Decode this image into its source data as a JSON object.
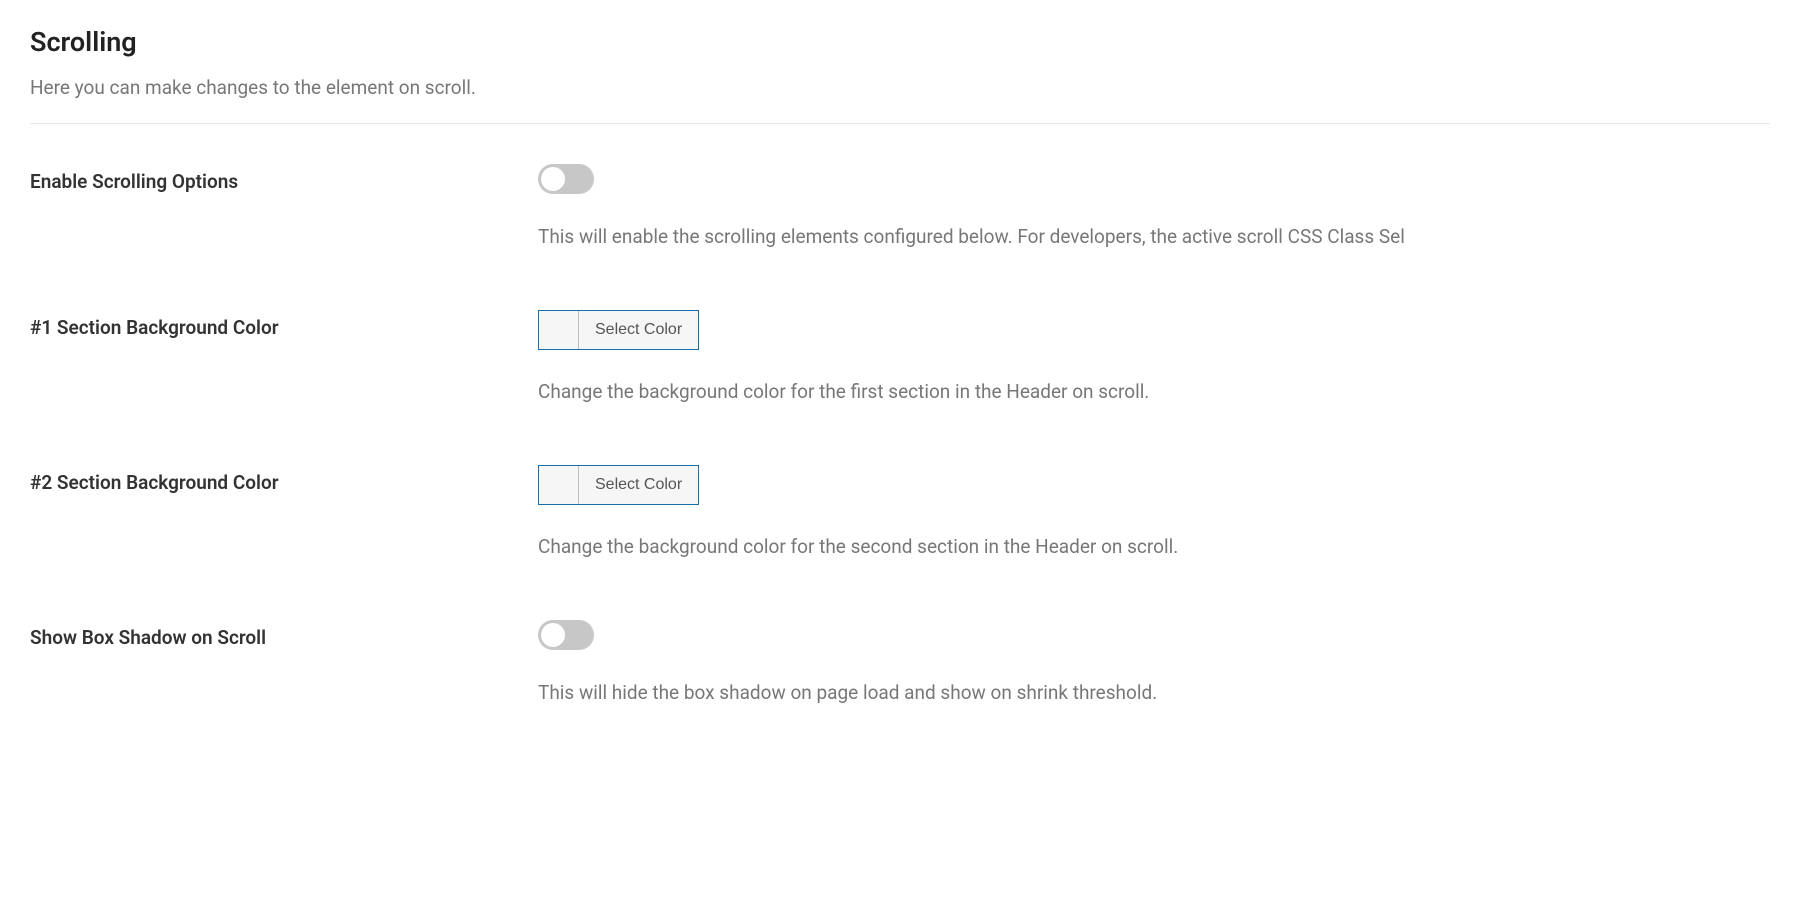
{
  "section": {
    "title": "Scrolling",
    "subtitle": "Here you can make changes to the element on scroll."
  },
  "fields": {
    "enable_scrolling": {
      "label": "Enable Scrolling Options",
      "help": "This will enable the scrolling elements configured below. For developers, the active scroll CSS Class Sel"
    },
    "bg_color_1": {
      "label": "#1 Section Background Color",
      "button": "Select Color",
      "help": "Change the background color for the first section in the Header on scroll."
    },
    "bg_color_2": {
      "label": "#2 Section Background Color",
      "button": "Select Color",
      "help": "Change the background color for the second section in the Header on scroll."
    },
    "box_shadow": {
      "label": "Show Box Shadow on Scroll",
      "help": "This will hide the box shadow on page load and show on shrink threshold."
    }
  }
}
